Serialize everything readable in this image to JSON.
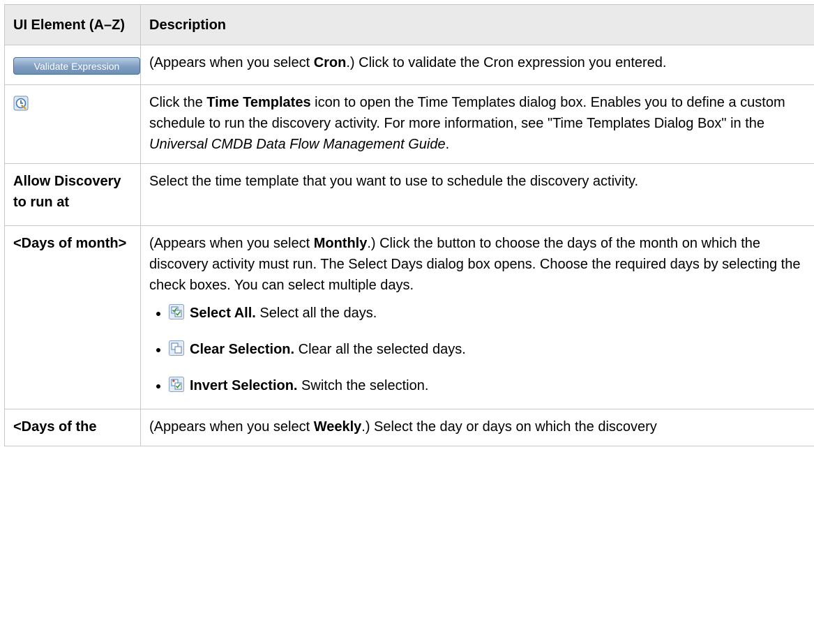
{
  "header": {
    "col1": "UI Element (A–Z)",
    "col2": "Description"
  },
  "rows": [
    {
      "button_label": "Validate Expression",
      "desc_a": "(Appears when you select ",
      "desc_b": "Cron",
      "desc_c": ".) Click to validate the Cron expression you entered."
    },
    {
      "icon": "time-templates-icon",
      "desc_a": "Click the ",
      "desc_b": "Time Templates",
      "desc_c": " icon to open the Time Templates dialog box. Enables you to define a custom schedule to run the discovery activity. For more information, see \"Time Templates Dialog Box\" in the ",
      "desc_d": "Universal CMDB Data Flow Management Guide",
      "desc_e": "."
    },
    {
      "name": "Allow Discovery to run at",
      "desc": "Select the time template that you want to use to schedule the discovery activity."
    },
    {
      "name": "<Days of month>",
      "desc_a": "(Appears when you select ",
      "desc_b": "Monthly",
      "desc_c": ".) Click the button to choose the days of the month on which the discovery activity must run. The Select Days dialog box opens. Choose the required days by selecting the check boxes. You can select multiple days.",
      "bullets": [
        {
          "icon": "select-all-icon",
          "label": "Select All.",
          "text": " Select all the days."
        },
        {
          "icon": "clear-selection-icon",
          "label": "Clear Selection.",
          "text": " Clear all the selected days."
        },
        {
          "icon": "invert-selection-icon",
          "label": "Invert Selection.",
          "text": " Switch the selection."
        }
      ]
    },
    {
      "name": "<Days of the",
      "desc_a": "(Appears when you select ",
      "desc_b": "Weekly",
      "desc_c": ".) Select the day or days on which the discovery"
    }
  ],
  "colors": {
    "header_bg": "#eaeaea",
    "border": "#c8c8c8",
    "button_blue": "#7e9dc0"
  }
}
